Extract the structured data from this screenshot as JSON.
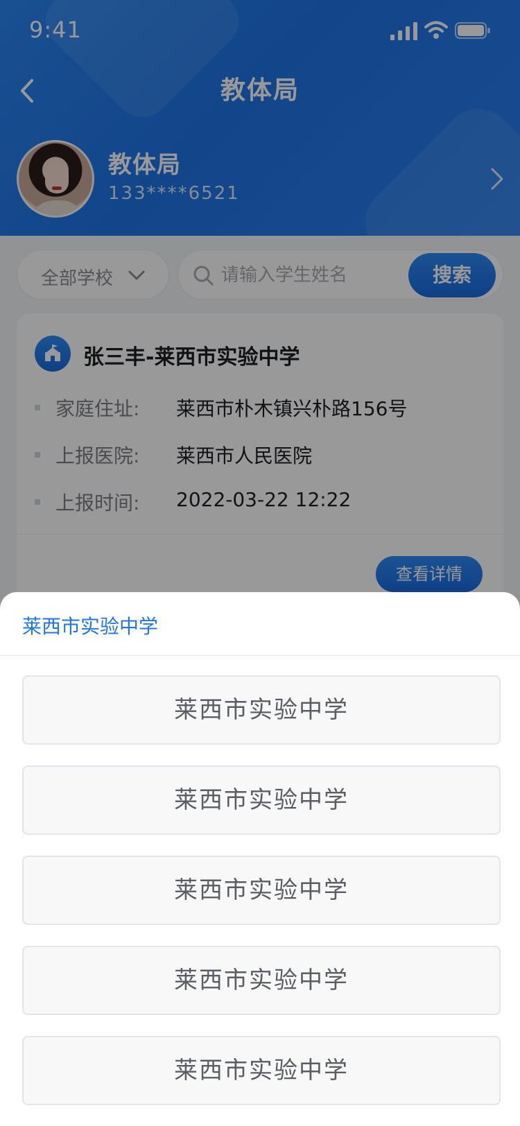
{
  "status_bar": {
    "time": "9:41"
  },
  "nav": {
    "title": "教体局"
  },
  "profile": {
    "name": "教体局",
    "phone": "133****6521"
  },
  "filter": {
    "school_select": "全部学校",
    "search_placeholder": "请输入学生姓名",
    "search_button": "搜索"
  },
  "card": {
    "title": "张三丰-莱西市实验中学",
    "fields": [
      {
        "label": "家庭住址:",
        "value": "莱西市朴木镇兴朴路156号"
      },
      {
        "label": "上报医院:",
        "value": "莱西市人民医院"
      },
      {
        "label": "上报时间:",
        "value": "2022-03-22 12:22"
      }
    ],
    "detail_button": "查看详情"
  },
  "sheet": {
    "title": "莱西市实验中学",
    "options": [
      "莱西市实验中学",
      "莱西市实验中学",
      "莱西市实验中学",
      "莱西市实验中学",
      "莱西市实验中学"
    ]
  },
  "colors": {
    "primary": "#1f74e6",
    "header_gradient_start": "#2a86f3",
    "sheet_title": "#1f74e6"
  },
  "icons": [
    "back-icon",
    "chevron-right-icon",
    "chevron-down-icon",
    "search-icon",
    "school-icon",
    "signal-icon",
    "wifi-icon",
    "battery-icon"
  ]
}
